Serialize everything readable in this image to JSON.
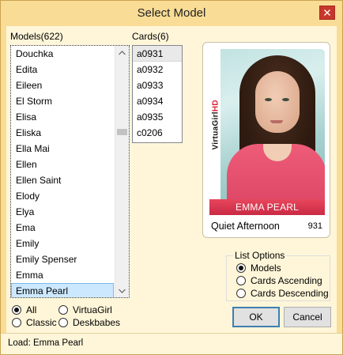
{
  "window": {
    "title": "Select Model"
  },
  "models": {
    "header": "Models(622)",
    "items": [
      "Douchka",
      "Edita",
      "Eileen",
      "El Storm",
      "Elisa",
      "Eliska",
      "Ella Mai",
      "Ellen",
      "Ellen Saint",
      "Elody",
      "Elya",
      "Ema",
      "Emily",
      "Emily Spenser",
      "Emma",
      "Emma Pearl"
    ],
    "selected": "Emma Pearl"
  },
  "cards": {
    "header": "Cards(6)",
    "items": [
      "a0931",
      "a0932",
      "a0933",
      "a0934",
      "a0935",
      "c0206"
    ],
    "highlighted": "a0931"
  },
  "card_preview": {
    "brand_prefix": "VirtuaGirl",
    "brand_suffix": "HD",
    "model_name": "EMMA PEARL",
    "card_title": "Quiet Afternoon",
    "card_number": "931"
  },
  "filters": {
    "all": "All",
    "virtuagirl": "VirtuaGirl",
    "classic": "Classic",
    "deskbabes": "Deskbabes",
    "selected": "all"
  },
  "list_options": {
    "title": "List Options",
    "models": "Models",
    "cards_ascending": "Cards Ascending",
    "cards_descending": "Cards Descending",
    "selected": "models"
  },
  "buttons": {
    "ok": "OK",
    "cancel": "Cancel"
  },
  "status": {
    "text": "Load: Emma Pearl"
  },
  "colors": {
    "window_bg": "#f9dc95",
    "client_bg": "#fff6d9",
    "selection": "#cce8ff",
    "close": "#c7372b",
    "banner": "#d63a52"
  }
}
